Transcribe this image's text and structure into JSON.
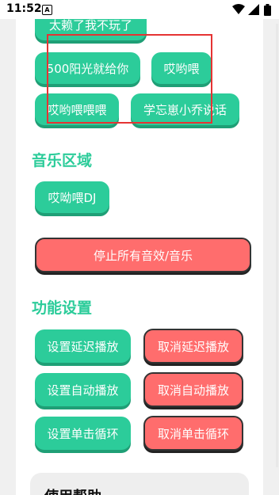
{
  "status_bar": {
    "time": "11:52",
    "notification_glyph": "A",
    "icons": [
      "wifi-icon",
      "signal-icon",
      "battery-icon"
    ]
  },
  "buttons_top": [
    "太赖了我不玩了",
    "500阳光就给你",
    "哎哟喂",
    "哎哟喂喂喂",
    "学忘崽小乔说话"
  ],
  "music": {
    "title": "音乐区域",
    "dj_button": "哎呦喂DJ",
    "stop_button": "停止所有音效/音乐"
  },
  "settings": {
    "title": "功能设置",
    "set_delay": "设置延迟播放",
    "cancel_delay": "取消延迟播放",
    "set_auto": "设置自动播放",
    "cancel_auto": "取消自动播放",
    "set_loop": "设置单击循环",
    "cancel_loop": "取消单击循环"
  },
  "help": {
    "title": "使用帮助"
  },
  "colors": {
    "accent_green": "#2ccc9a",
    "danger_red": "#ff6d6d",
    "highlight_box": "#e53333"
  }
}
